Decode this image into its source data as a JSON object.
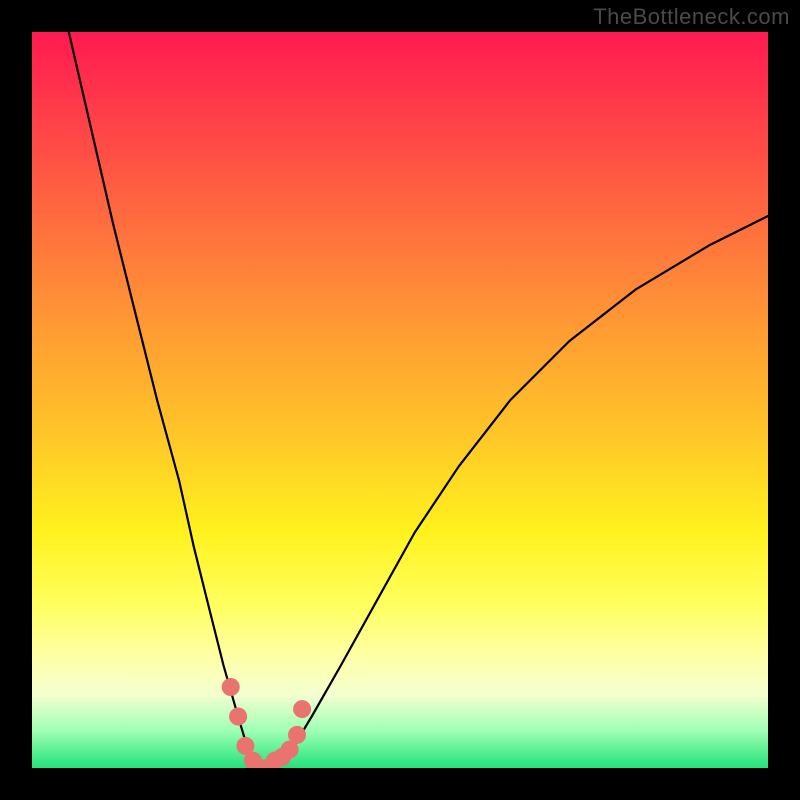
{
  "watermark": {
    "text": "TheBottleneck.com"
  },
  "chart_data": {
    "type": "line",
    "title": "",
    "xlabel": "",
    "ylabel": "",
    "xlim": [
      0,
      100
    ],
    "ylim": [
      0,
      100
    ],
    "series": [
      {
        "name": "bottleneck-curve",
        "x": [
          5,
          8,
          11,
          14,
          17,
          20,
          22,
          24,
          26,
          28,
          29.5,
          31,
          33,
          35,
          38,
          42,
          47,
          52,
          58,
          65,
          73,
          82,
          92,
          100
        ],
        "values": [
          100,
          87,
          74,
          62,
          50,
          39,
          30,
          22,
          14,
          7,
          2,
          0,
          0,
          2,
          7,
          14,
          23,
          32,
          41,
          50,
          58,
          65,
          71,
          75
        ]
      }
    ],
    "markers": {
      "name": "highlight-dots",
      "color": "#e9736f",
      "x": [
        27,
        28,
        29,
        30,
        31,
        32,
        33,
        34,
        35,
        36,
        36.7
      ],
      "values": [
        11,
        7,
        3,
        1,
        0,
        0,
        1,
        1.5,
        2.5,
        4.5,
        8
      ]
    },
    "background_gradient": {
      "orientation": "vertical",
      "stops": [
        {
          "pos": 0.0,
          "color": "#ff1a52"
        },
        {
          "pos": 0.25,
          "color": "#ff6a3f"
        },
        {
          "pos": 0.55,
          "color": "#ffc728"
        },
        {
          "pos": 0.78,
          "color": "#ffff60"
        },
        {
          "pos": 0.95,
          "color": "#9dffb4"
        },
        {
          "pos": 1.0,
          "color": "#23e27a"
        }
      ]
    }
  }
}
